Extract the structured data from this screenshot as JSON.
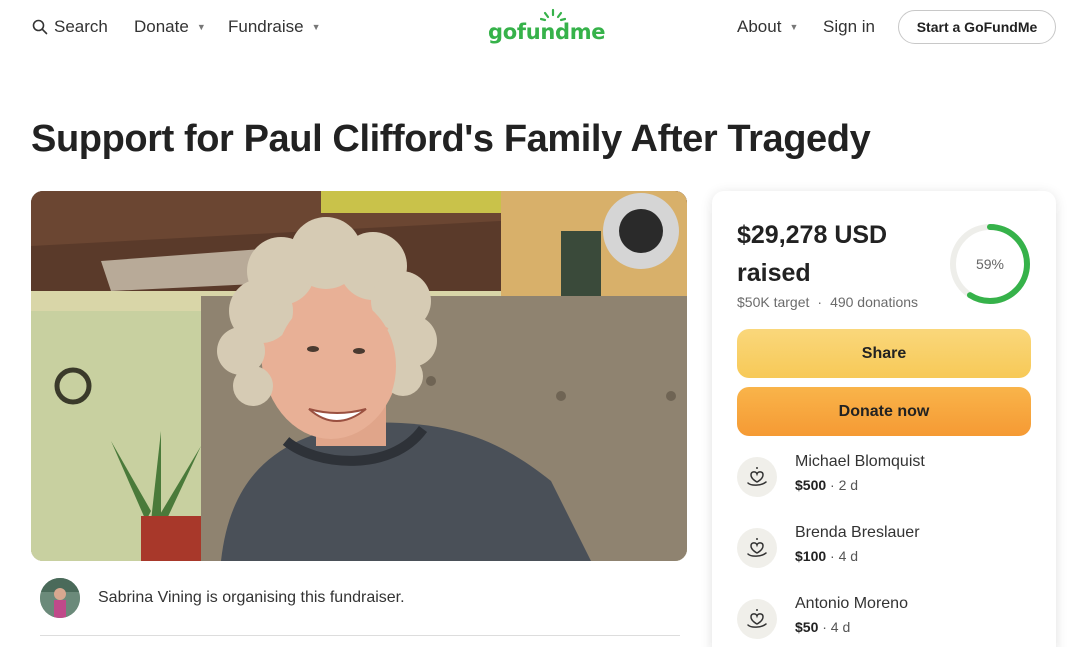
{
  "nav": {
    "search_label": "Search",
    "donate_label": "Donate",
    "fundraise_label": "Fundraise",
    "logo_text": "gofundme",
    "about_label": "About",
    "signin_label": "Sign in",
    "start_label": "Start a GoFundMe"
  },
  "page": {
    "title": "Support for Paul Clifford's Family After Tragedy"
  },
  "organiser": {
    "text": "Sabrina Vining is organising this fundraiser."
  },
  "donation_card": {
    "raised_amount": "$29,278 USD",
    "raised_label": "raised",
    "target": "$50K target",
    "separator": "·",
    "donations_count": "490 donations",
    "progress_label": "59%",
    "progress_fraction": 0.59,
    "share_label": "Share",
    "donate_label": "Donate now",
    "donations": [
      {
        "name": "Michael Blomquist",
        "amount": "$500",
        "time": " · 2 d"
      },
      {
        "name": "Brenda Breslauer",
        "amount": "$100",
        "time": " · 4 d"
      },
      {
        "name": "Antonio Moreno",
        "amount": "$50",
        "time": " · 4 d"
      }
    ]
  },
  "colors": {
    "brand_green": "#36b24a",
    "share_yellow": "#f7c957",
    "donate_orange": "#f59a34"
  }
}
